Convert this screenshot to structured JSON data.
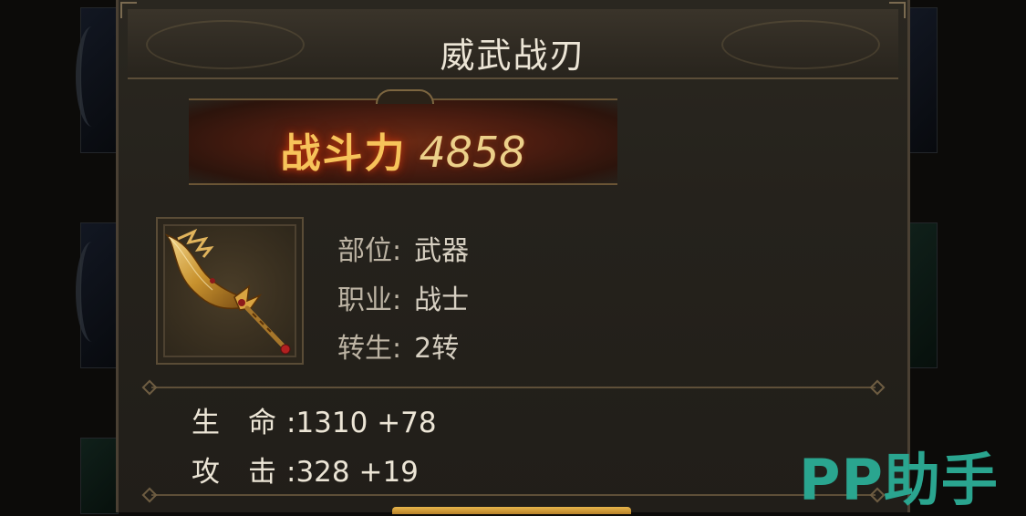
{
  "item": {
    "name": "威武战刃",
    "icon": "golden-broadsword-icon"
  },
  "power": {
    "label": "战斗力",
    "value": "4858"
  },
  "attributes": [
    {
      "label": "部位:",
      "value": "武器"
    },
    {
      "label": "职业:",
      "value": "战士"
    },
    {
      "label": "转生:",
      "value": "2转"
    }
  ],
  "stats": [
    {
      "k1": "生",
      "k2": "命",
      "value": ":1310 +78"
    },
    {
      "k1": "攻",
      "k2": "击",
      "value": ":328 +19"
    }
  ],
  "watermark": "PP助手",
  "colors": {
    "power_gold": "#f7c35a",
    "power_glow": "#c23a10",
    "watermark": "#2aa58f"
  }
}
